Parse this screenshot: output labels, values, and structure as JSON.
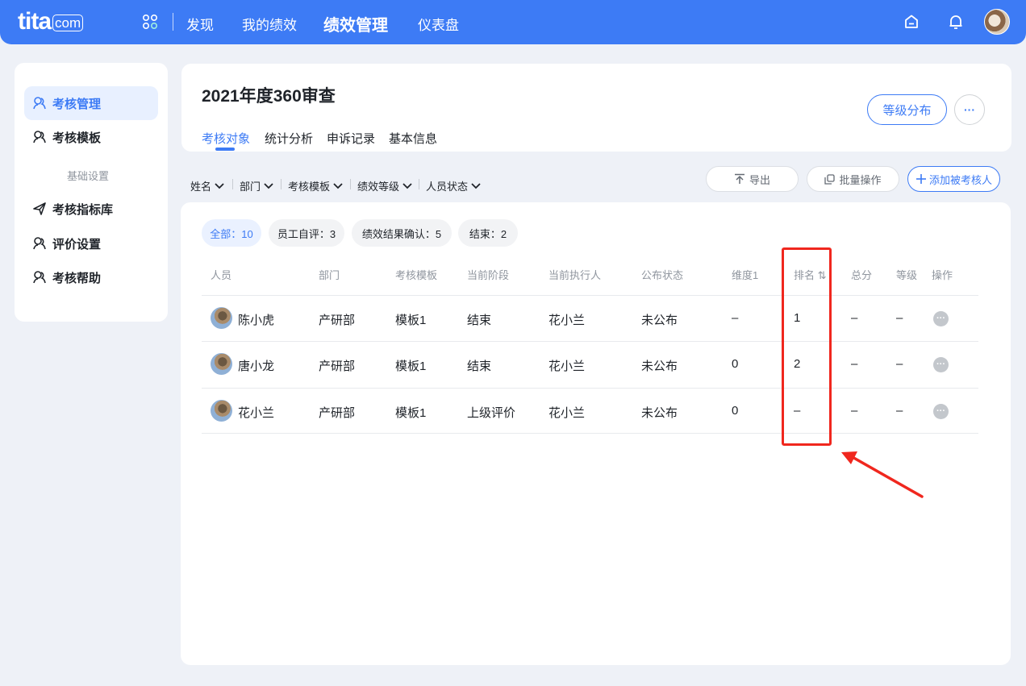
{
  "topbar": {
    "logo_main": "tita",
    "logo_suffix": "com",
    "nav": [
      {
        "label": "发现"
      },
      {
        "label": "我的绩效"
      },
      {
        "label": "绩效管理"
      },
      {
        "label": "仪表盘"
      }
    ],
    "icons": [
      "apps-icon",
      "home-icon",
      "bell-icon",
      "user-avatar"
    ]
  },
  "sidebar": {
    "items": [
      {
        "label": "考核管理",
        "icon": "people-icon"
      },
      {
        "label": "考核模板",
        "icon": "people-icon"
      },
      {
        "label": "基础设置"
      },
      {
        "label": "考核指标库",
        "icon": "send-icon"
      },
      {
        "label": "评价设置",
        "icon": "people-icon"
      },
      {
        "label": "考核帮助",
        "icon": "people-icon"
      }
    ]
  },
  "header": {
    "title": "2021年度360审查",
    "tabs": [
      {
        "label": "考核对象"
      },
      {
        "label": "统计分析"
      },
      {
        "label": "申诉记录"
      },
      {
        "label": "基本信息"
      }
    ],
    "grade_button": "等级分布",
    "more_button": "···"
  },
  "filters": [
    {
      "label": "姓名"
    },
    {
      "label": "部门"
    },
    {
      "label": "考核模板"
    },
    {
      "label": "绩效等级"
    },
    {
      "label": "人员状态"
    }
  ],
  "actions": {
    "export": "导出",
    "batch": "批量操作",
    "add": "添加被考核人"
  },
  "chips": [
    {
      "label": "全部：10"
    },
    {
      "label": "员工自评：3"
    },
    {
      "label": "绩效结果确认：5"
    },
    {
      "label": "结束：2"
    }
  ],
  "table": {
    "headers": [
      "人员",
      "部门",
      "考核模板",
      "当前阶段",
      "当前执行人",
      "公布状态",
      "维度1",
      "排名 ⇅",
      "总分",
      "等级",
      "操作"
    ],
    "rows": [
      {
        "name": "陈小虎",
        "dept": "产研部",
        "template": "模板1",
        "stage": "结束",
        "executor": "花小兰",
        "publish": "未公布",
        "dim1": "–",
        "rank": "1",
        "total": "–",
        "grade": "–"
      },
      {
        "name": "唐小龙",
        "dept": "产研部",
        "template": "模板1",
        "stage": "结束",
        "executor": "花小兰",
        "publish": "未公布",
        "dim1": "0",
        "rank": "2",
        "total": "–",
        "grade": "–"
      },
      {
        "name": "花小兰",
        "dept": "产研部",
        "template": "模板1",
        "stage": "上级评价",
        "executor": "花小兰",
        "publish": "未公布",
        "dim1": "0",
        "rank": "–",
        "total": "–",
        "grade": "–"
      }
    ],
    "row_action": "···"
  },
  "colors": {
    "brand": "#3d7bf5",
    "annotation": "#f0271e"
  }
}
